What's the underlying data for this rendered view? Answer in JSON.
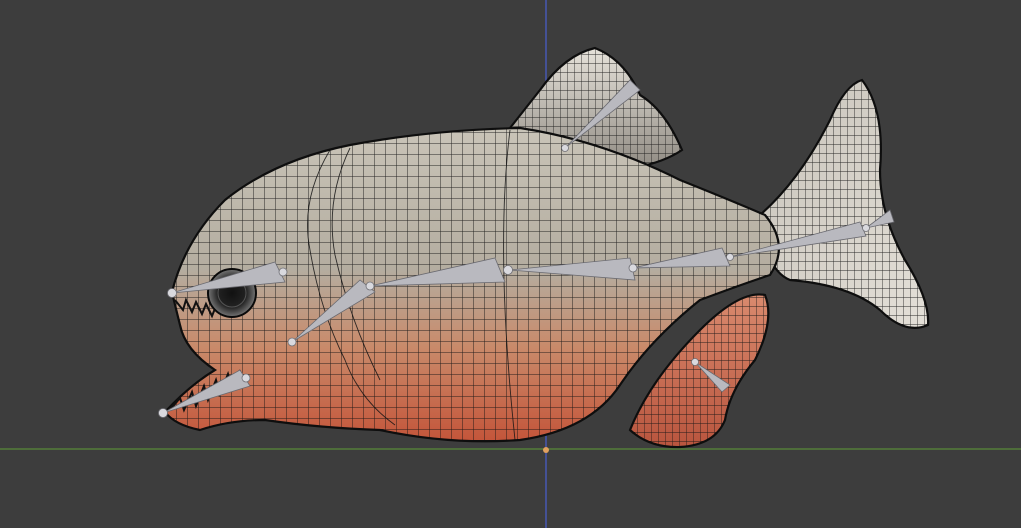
{
  "viewport": {
    "background_color": "#3d3d3d",
    "axis_x_color": "#5a8a3a",
    "axis_z_color": "#4a5fd0",
    "origin_marker_color": "#e0a060"
  },
  "model": {
    "object": "piranha-mesh",
    "display": "textured-wireframe",
    "armature": "fish-armature",
    "body_top_color": "#b8b3a8",
    "body_bottom_color": "#c76a4a",
    "wire_color": "#141414",
    "bone_color": "#b9b9bf"
  }
}
